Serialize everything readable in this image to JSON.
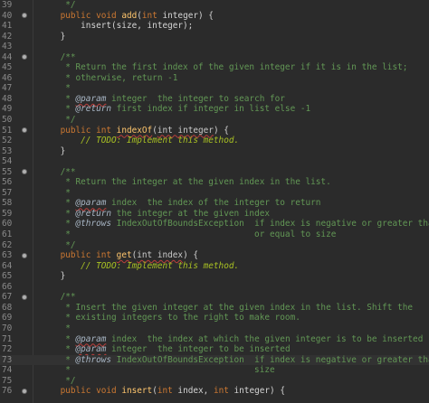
{
  "editor": {
    "lines": [
      {
        "n": "39",
        "fold": false,
        "current": false,
        "tokens": [
          {
            "t": "     */",
            "c": "comment"
          }
        ]
      },
      {
        "n": "40",
        "fold": true,
        "current": false,
        "tokens": [
          {
            "t": "    ",
            "c": "plain"
          },
          {
            "t": "public void ",
            "c": "keyword"
          },
          {
            "t": "add",
            "c": "method"
          },
          {
            "t": "(",
            "c": "plain"
          },
          {
            "t": "int",
            "c": "keyword"
          },
          {
            "t": " integer) {",
            "c": "plain"
          }
        ]
      },
      {
        "n": "41",
        "fold": false,
        "current": false,
        "tokens": [
          {
            "t": "        insert(size, integer);",
            "c": "plain"
          }
        ]
      },
      {
        "n": "42",
        "fold": false,
        "current": false,
        "tokens": [
          {
            "t": "    }",
            "c": "plain"
          }
        ]
      },
      {
        "n": "43",
        "fold": false,
        "current": false,
        "tokens": [
          {
            "t": "",
            "c": "plain"
          }
        ]
      },
      {
        "n": "44",
        "fold": true,
        "current": false,
        "tokens": [
          {
            "t": "    /**",
            "c": "comment"
          }
        ]
      },
      {
        "n": "45",
        "fold": false,
        "current": false,
        "tokens": [
          {
            "t": "     * Return the first index of the given integer if it is in the list;",
            "c": "comment"
          }
        ]
      },
      {
        "n": "46",
        "fold": false,
        "current": false,
        "tokens": [
          {
            "t": "     * otherwise, return -1",
            "c": "comment"
          }
        ]
      },
      {
        "n": "47",
        "fold": false,
        "current": false,
        "tokens": [
          {
            "t": "     *",
            "c": "comment"
          }
        ]
      },
      {
        "n": "48",
        "fold": false,
        "current": false,
        "tokens": [
          {
            "t": "     * ",
            "c": "comment"
          },
          {
            "t": "@param",
            "c": "tag-squiggle"
          },
          {
            "t": " integer  the integer to search for",
            "c": "comment"
          }
        ]
      },
      {
        "n": "49",
        "fold": false,
        "current": false,
        "tokens": [
          {
            "t": "     * ",
            "c": "comment"
          },
          {
            "t": "@return",
            "c": "tag"
          },
          {
            "t": " first index if integer in list else -1",
            "c": "comment"
          }
        ]
      },
      {
        "n": "50",
        "fold": false,
        "current": false,
        "tokens": [
          {
            "t": "     */",
            "c": "comment"
          }
        ]
      },
      {
        "n": "51",
        "fold": true,
        "current": false,
        "tokens": [
          {
            "t": "    ",
            "c": "plain"
          },
          {
            "t": "public int ",
            "c": "keyword"
          },
          {
            "t": "indexOf",
            "c": "method-squiggle"
          },
          {
            "t": "(",
            "c": "plain"
          },
          {
            "t": "int integer",
            "c": "param-squiggle"
          },
          {
            "t": ") {",
            "c": "plain"
          }
        ]
      },
      {
        "n": "52",
        "fold": false,
        "current": false,
        "tokens": [
          {
            "t": "        ",
            "c": "plain"
          },
          {
            "t": "// TODO: Implement this method.",
            "c": "todo"
          }
        ]
      },
      {
        "n": "53",
        "fold": false,
        "current": false,
        "tokens": [
          {
            "t": "    }",
            "c": "plain"
          }
        ]
      },
      {
        "n": "54",
        "fold": false,
        "current": false,
        "tokens": [
          {
            "t": "",
            "c": "plain"
          }
        ]
      },
      {
        "n": "55",
        "fold": true,
        "current": false,
        "tokens": [
          {
            "t": "    /**",
            "c": "comment"
          }
        ]
      },
      {
        "n": "56",
        "fold": false,
        "current": false,
        "tokens": [
          {
            "t": "     * Return the integer at the given index in the list.",
            "c": "comment"
          }
        ]
      },
      {
        "n": "57",
        "fold": false,
        "current": false,
        "tokens": [
          {
            "t": "     *",
            "c": "comment"
          }
        ]
      },
      {
        "n": "58",
        "fold": false,
        "current": false,
        "tokens": [
          {
            "t": "     * ",
            "c": "comment"
          },
          {
            "t": "@param",
            "c": "tag-squiggle"
          },
          {
            "t": " index  the index of the integer to return",
            "c": "comment"
          }
        ]
      },
      {
        "n": "59",
        "fold": false,
        "current": false,
        "tokens": [
          {
            "t": "     * ",
            "c": "comment"
          },
          {
            "t": "@return",
            "c": "tag"
          },
          {
            "t": " the integer at the given index",
            "c": "comment"
          }
        ]
      },
      {
        "n": "60",
        "fold": false,
        "current": false,
        "tokens": [
          {
            "t": "     * ",
            "c": "comment"
          },
          {
            "t": "@throws",
            "c": "tag"
          },
          {
            "t": " IndexOutOfBoundsException  if index is negative or greater than",
            "c": "comment"
          }
        ]
      },
      {
        "n": "61",
        "fold": false,
        "current": false,
        "tokens": [
          {
            "t": "     *                                    or equal to size",
            "c": "comment"
          }
        ]
      },
      {
        "n": "62",
        "fold": false,
        "current": false,
        "tokens": [
          {
            "t": "     */",
            "c": "comment"
          }
        ]
      },
      {
        "n": "63",
        "fold": true,
        "current": false,
        "tokens": [
          {
            "t": "    ",
            "c": "plain"
          },
          {
            "t": "public int ",
            "c": "keyword"
          },
          {
            "t": "get",
            "c": "method-squiggle"
          },
          {
            "t": "(",
            "c": "plain"
          },
          {
            "t": "int index",
            "c": "param-squiggle"
          },
          {
            "t": ") {",
            "c": "plain"
          }
        ]
      },
      {
        "n": "64",
        "fold": false,
        "current": false,
        "tokens": [
          {
            "t": "        ",
            "c": "plain"
          },
          {
            "t": "// TODO: Implement this method.",
            "c": "todo"
          }
        ]
      },
      {
        "n": "65",
        "fold": false,
        "current": false,
        "tokens": [
          {
            "t": "    }",
            "c": "plain"
          }
        ]
      },
      {
        "n": "66",
        "fold": false,
        "current": false,
        "tokens": [
          {
            "t": "",
            "c": "plain"
          }
        ]
      },
      {
        "n": "67",
        "fold": true,
        "current": false,
        "tokens": [
          {
            "t": "    /**",
            "c": "comment"
          }
        ]
      },
      {
        "n": "68",
        "fold": false,
        "current": false,
        "tokens": [
          {
            "t": "     * Insert the given integer at the given index in the list. Shift the",
            "c": "comment"
          }
        ]
      },
      {
        "n": "69",
        "fold": false,
        "current": false,
        "tokens": [
          {
            "t": "     * existing integers to the right to make room.",
            "c": "comment"
          }
        ]
      },
      {
        "n": "70",
        "fold": false,
        "current": false,
        "tokens": [
          {
            "t": "     *",
            "c": "comment"
          }
        ]
      },
      {
        "n": "71",
        "fold": false,
        "current": false,
        "tokens": [
          {
            "t": "     * ",
            "c": "comment"
          },
          {
            "t": "@param",
            "c": "tag-squiggle"
          },
          {
            "t": " index  the index at which the given integer is to be inserted",
            "c": "comment"
          }
        ]
      },
      {
        "n": "72",
        "fold": false,
        "current": false,
        "tokens": [
          {
            "t": "     * ",
            "c": "comment"
          },
          {
            "t": "@param",
            "c": "tag-squiggle"
          },
          {
            "t": " integer  the integer to be inserted",
            "c": "comment"
          }
        ]
      },
      {
        "n": "73",
        "fold": false,
        "current": true,
        "tokens": [
          {
            "t": "     * ",
            "c": "comment"
          },
          {
            "t": "@throws",
            "c": "tag"
          },
          {
            "t": " IndexOutOfBoundsException  if index is negative or greater than",
            "c": "comment"
          }
        ]
      },
      {
        "n": "74",
        "fold": false,
        "current": false,
        "tokens": [
          {
            "t": "     *                                    size",
            "c": "comment"
          }
        ]
      },
      {
        "n": "75",
        "fold": false,
        "current": false,
        "tokens": [
          {
            "t": "     */",
            "c": "comment"
          }
        ]
      },
      {
        "n": "76",
        "fold": true,
        "current": false,
        "tokens": [
          {
            "t": "    ",
            "c": "plain"
          },
          {
            "t": "public void ",
            "c": "keyword"
          },
          {
            "t": "insert",
            "c": "method"
          },
          {
            "t": "(",
            "c": "plain"
          },
          {
            "t": "int",
            "c": "keyword"
          },
          {
            "t": " index, ",
            "c": "plain"
          },
          {
            "t": "int",
            "c": "keyword"
          },
          {
            "t": " integer) {",
            "c": "plain"
          }
        ]
      }
    ]
  }
}
